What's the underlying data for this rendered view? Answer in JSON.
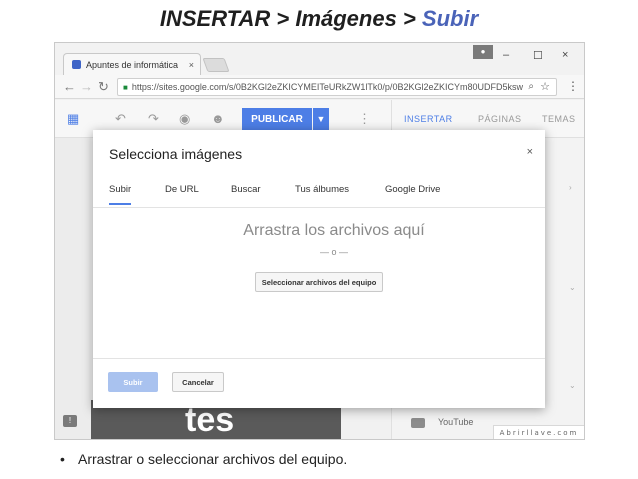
{
  "slide": {
    "title_main": "INSERTAR > Imágenes > ",
    "title_accent": "Subir",
    "bullet": "Arrastrar o seleccionar archivos del equipo."
  },
  "browser": {
    "tab_title": "Apuntes de informática",
    "tab_close": "×",
    "url_prefix": "https://",
    "url": "sites.google.com/s/0B2KGl2eZKICYMEITeURkZW1lTk0/p/0B2KGl2eZKICYm80UDFD5ksw",
    "window_min": "–",
    "window_max": "☐",
    "window_close": "×"
  },
  "editor": {
    "publish_label": "PUBLICAR",
    "tabs": [
      "INSERTAR",
      "PÁGINAS",
      "TEMAS"
    ],
    "canvas_text": "tes",
    "side_item": "YouTube",
    "watermark": "Abrirllave.com"
  },
  "dialog": {
    "title": "Selecciona imágenes",
    "close": "×",
    "tabs": [
      "Subir",
      "De URL",
      "Buscar",
      "Tus álbumes",
      "Google Drive"
    ],
    "drop_text": "Arrastra los archivos aquí",
    "or_text": "— o —",
    "select_button": "Seleccionar archivos del equipo",
    "upload_button": "Subir",
    "cancel_button": "Cancelar"
  },
  "colors": {
    "accent": "#4d7ee6",
    "title_accent": "#4a63b8"
  }
}
